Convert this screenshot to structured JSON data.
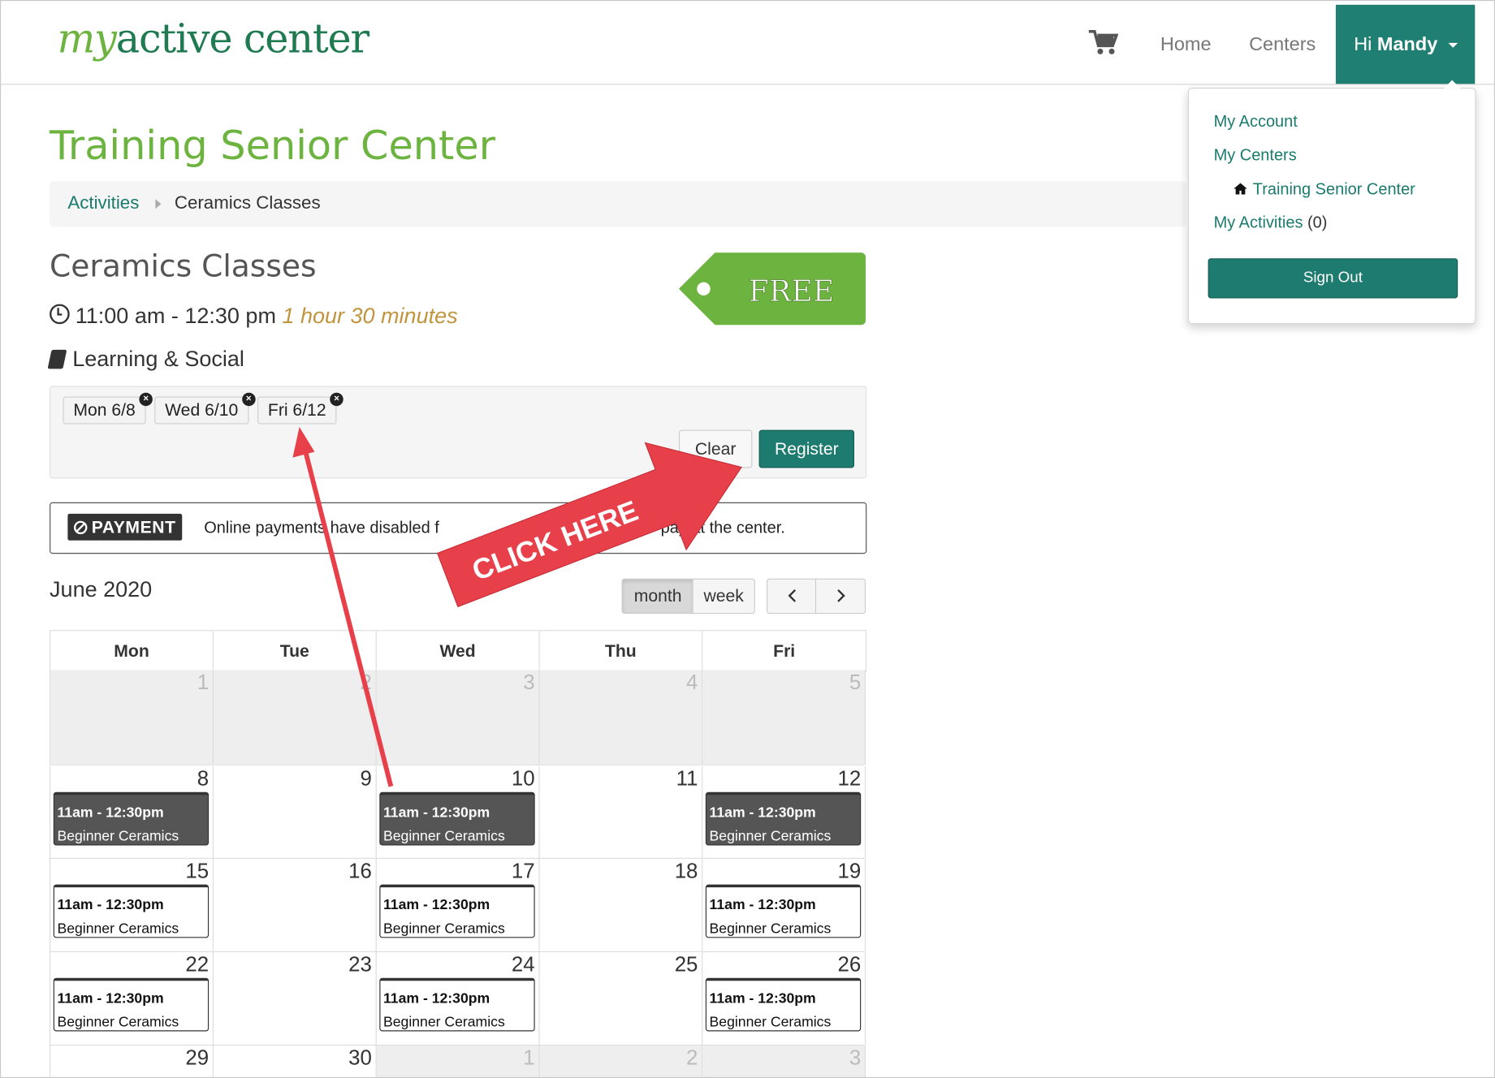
{
  "brand": {
    "my": "my",
    "rest": "active center"
  },
  "nav": {
    "home": "Home",
    "centers": "Centers",
    "greeting": "Hi",
    "user": "Mandy"
  },
  "user_menu": {
    "my_account": "My Account",
    "my_centers": "My Centers",
    "center": "Training Senior Center",
    "my_activities": "My Activities",
    "activities_count": "(0)",
    "sign_out": "Sign Out"
  },
  "page": {
    "title": "Training Senior Center",
    "breadcrumb": [
      "Activities",
      "Ceramics Classes"
    ]
  },
  "activity": {
    "title": "Ceramics Classes",
    "time": "11:00 am - 12:30 pm",
    "duration": "1 hour 30 minutes",
    "category": "Learning & Social",
    "price": "FREE"
  },
  "selection": {
    "dates": [
      "Mon 6/8",
      "Wed 6/10",
      "Fri 6/12"
    ],
    "clear": "Clear",
    "register": "Register"
  },
  "payment": {
    "badge": "PAYMENT",
    "text_left": "Online payments have disabled f",
    "text_right": "pay at the center."
  },
  "annotation": {
    "callout": "CLICK HERE"
  },
  "calendar": {
    "title": "June 2020",
    "views": [
      "month",
      "week"
    ],
    "active_view": "month",
    "days": [
      "Mon",
      "Tue",
      "Wed",
      "Thu",
      "Fri"
    ],
    "weeks": [
      [
        {
          "d": "1",
          "other": true
        },
        {
          "d": "2",
          "other": true
        },
        {
          "d": "3",
          "other": true
        },
        {
          "d": "4",
          "other": true
        },
        {
          "d": "5",
          "other": true
        }
      ],
      [
        {
          "d": "8",
          "ev": "sel"
        },
        {
          "d": "9"
        },
        {
          "d": "10",
          "ev": "sel"
        },
        {
          "d": "11"
        },
        {
          "d": "12",
          "ev": "sel"
        }
      ],
      [
        {
          "d": "15",
          "ev": "open"
        },
        {
          "d": "16"
        },
        {
          "d": "17",
          "ev": "open"
        },
        {
          "d": "18"
        },
        {
          "d": "19",
          "ev": "open"
        }
      ],
      [
        {
          "d": "22",
          "ev": "open"
        },
        {
          "d": "23"
        },
        {
          "d": "24",
          "ev": "open"
        },
        {
          "d": "25"
        },
        {
          "d": "26",
          "ev": "open"
        }
      ],
      [
        {
          "d": "29"
        },
        {
          "d": "30"
        },
        {
          "d": "1",
          "other": true
        },
        {
          "d": "2",
          "other": true
        },
        {
          "d": "3",
          "other": true
        }
      ]
    ],
    "event": {
      "time": "11am - 12:30pm",
      "name": "Beginner Ceramics"
    }
  },
  "colors": {
    "brand_green": "#6db33f",
    "teal": "#1e7b6f",
    "callout_red": "#e8404a"
  }
}
